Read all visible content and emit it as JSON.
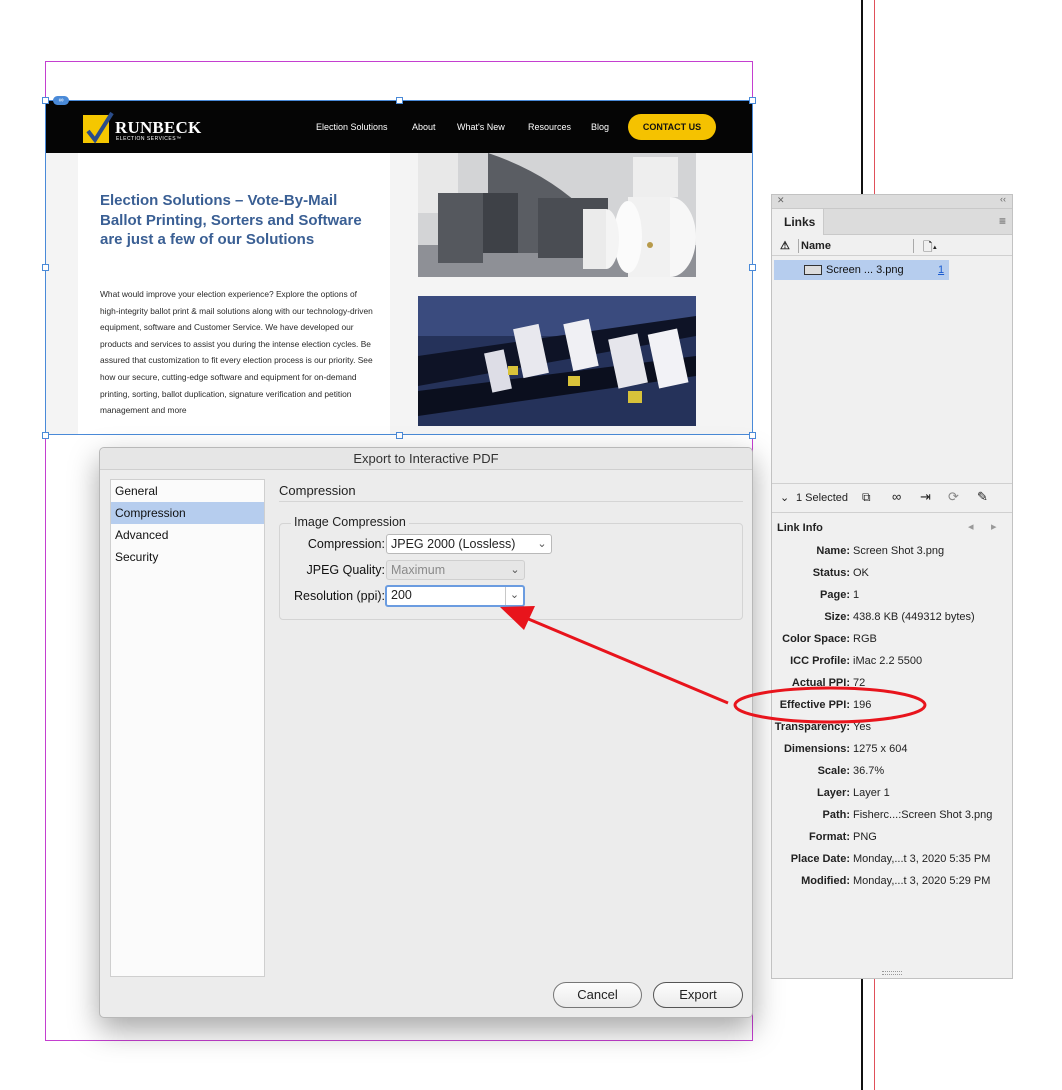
{
  "website": {
    "logo_name": "RUNBECK",
    "logo_sub": "ELECTION SERVICES™",
    "nav": [
      "Election Solutions",
      "About",
      "What's New",
      "Resources",
      "Blog"
    ],
    "contact": "CONTACT US",
    "heading": "Election Solutions – Vote-By-Mail Ballot Printing, Sorters and Software are just a few of our Solutions",
    "body": "What would improve your election experience? Explore the options of high-integrity ballot print & mail solutions along with our technology-driven equipment, software and Customer Service. We have developed our products and services to assist you during the intense election cycles. Be assured that customization to fit every election process is our priority. See how our secure, cutting-edge software and equipment for on-demand printing, sorting, ballot duplication, signature verification and petition management and more"
  },
  "dialog": {
    "title": "Export to Interactive PDF",
    "sidebar": [
      "General",
      "Compression",
      "Advanced",
      "Security"
    ],
    "selected_sidebar": "Compression",
    "section": "Compression",
    "group": "Image Compression",
    "compression_label": "Compression:",
    "compression_value": "JPEG 2000 (Lossless)",
    "quality_label": "JPEG Quality:",
    "quality_value": "Maximum",
    "resolution_label": "Resolution (ppi):",
    "resolution_value": "200",
    "cancel": "Cancel",
    "export": "Export"
  },
  "links_panel": {
    "tab": "Links",
    "col_name": "Name",
    "link_name": "Screen ... 3.png",
    "link_page": "1",
    "selected_count": "1 Selected",
    "info_title": "Link Info",
    "info": [
      {
        "label": "Name:",
        "value": "Screen Shot 3.png"
      },
      {
        "label": "Status:",
        "value": "OK"
      },
      {
        "label": "Page:",
        "value": "1"
      },
      {
        "label": "Size:",
        "value": "438.8 KB (449312 bytes)"
      },
      {
        "label": "Color Space:",
        "value": "RGB"
      },
      {
        "label": "ICC Profile:",
        "value": "iMac 2.2 5500"
      },
      {
        "label": "Actual PPI:",
        "value": "72"
      },
      {
        "label": "Effective PPI:",
        "value": "196"
      },
      {
        "label": "Transparency:",
        "value": "Yes"
      },
      {
        "label": "Dimensions:",
        "value": "1275 x 604"
      },
      {
        "label": "Scale:",
        "value": "36.7%"
      },
      {
        "label": "Layer:",
        "value": "Layer 1"
      },
      {
        "label": "Path:",
        "value": "Fisherc...:Screen Shot 3.png"
      },
      {
        "label": "Format:",
        "value": "PNG"
      },
      {
        "label": "Place Date:",
        "value": "Monday,...t 3, 2020 5:35 PM"
      },
      {
        "label": "Modified:",
        "value": "Monday,...t 3, 2020 5:29 PM"
      }
    ]
  },
  "colors": {
    "selection": "#b6cdee",
    "annotation": "#e8141c",
    "frame": "#4a8ad8",
    "margin": "#c43fd0",
    "site_heading": "#3a5f94",
    "contact_button": "#f5c200"
  }
}
